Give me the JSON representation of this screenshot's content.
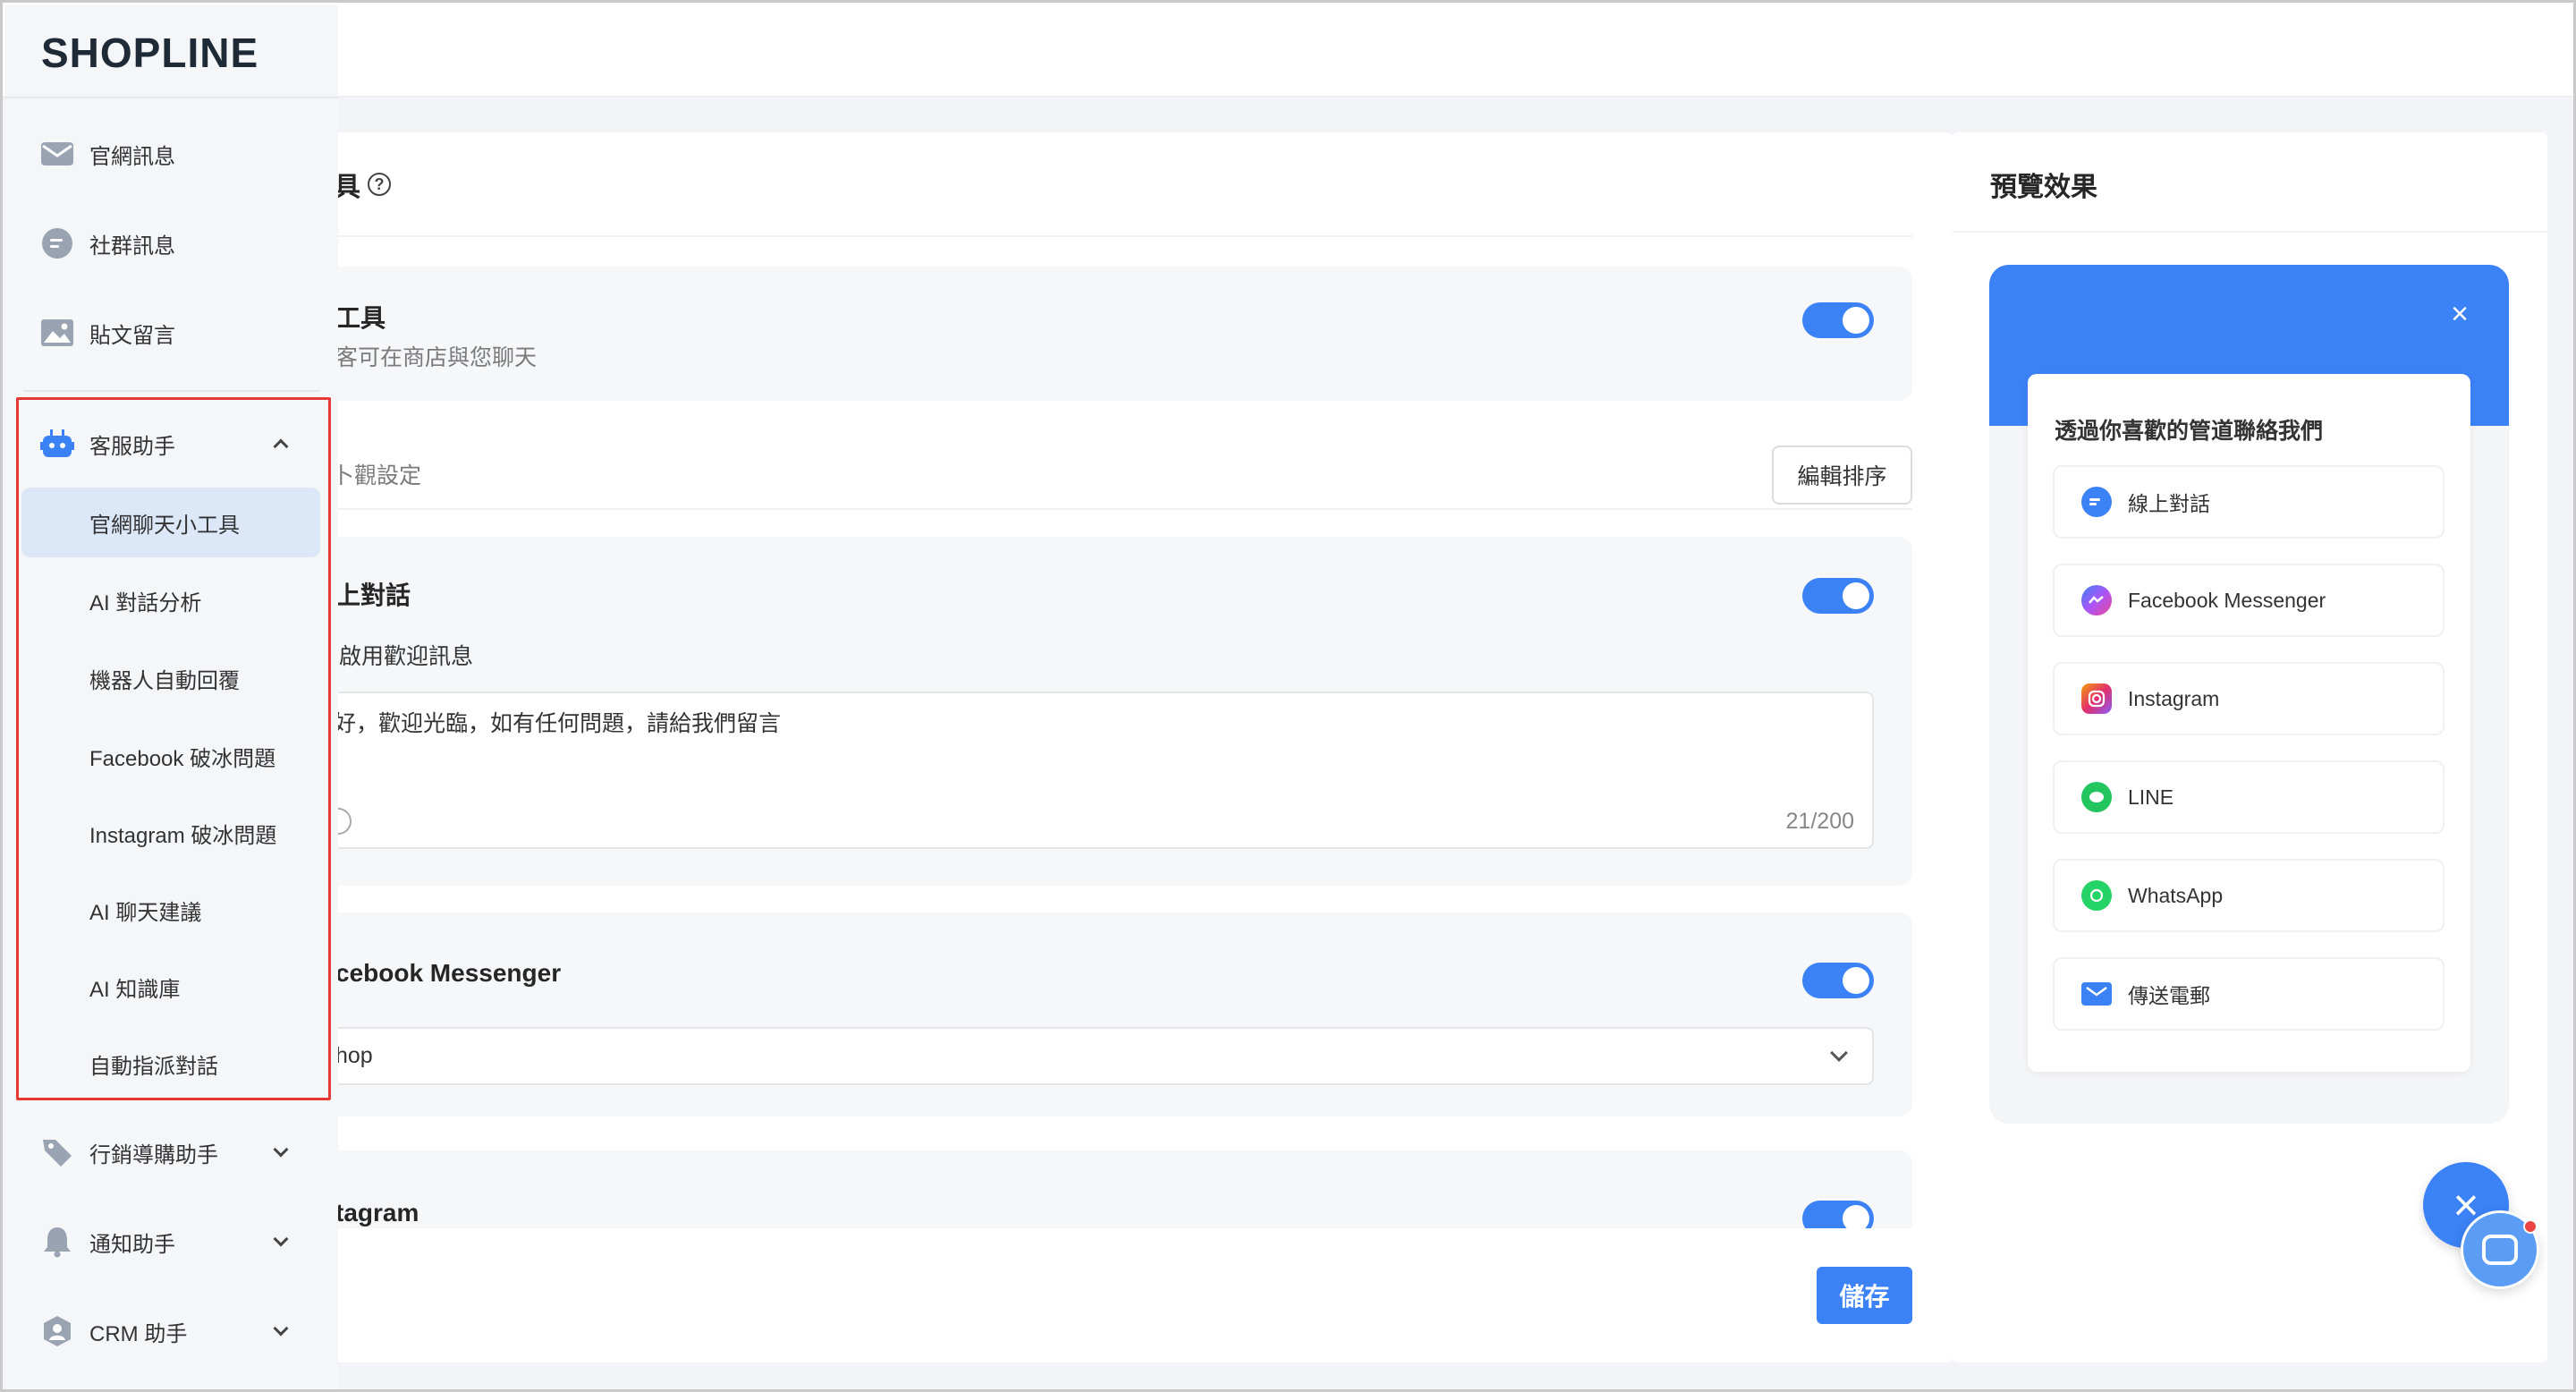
{
  "colors": {
    "accent": "#3b82f6",
    "highlight": "#e53935",
    "sidebar_active": "#dce7f8"
  },
  "sidebar": {
    "logo": "SHOPLINE",
    "items": [
      {
        "label": "官網訊息",
        "icon": "mail-icon"
      },
      {
        "label": "社群訊息",
        "icon": "chat-bubble-icon"
      },
      {
        "label": "貼文留言",
        "icon": "image-icon"
      }
    ],
    "group": {
      "label": "客服助手",
      "icon": "robot-icon",
      "expanded": true,
      "children": [
        {
          "label": "官網聊天小工具",
          "active": true
        },
        {
          "label": "AI 對話分析"
        },
        {
          "label": "機器人自動回覆"
        },
        {
          "label": "Facebook 破冰問題"
        },
        {
          "label": "Instagram 破冰問題"
        },
        {
          "label": "AI 聊天建議"
        },
        {
          "label": "AI 知識庫"
        },
        {
          "label": "自動指派對話"
        }
      ]
    },
    "collapsed_groups": [
      {
        "label": "行銷導購助手",
        "icon": "tag-icon"
      },
      {
        "label": "通知助手",
        "icon": "bell-icon"
      },
      {
        "label": "CRM 助手",
        "icon": "crm-icon"
      }
    ]
  },
  "main": {
    "heading": "具",
    "chat_tool": {
      "title": "工具",
      "subtitle": "客可在商店與您聊天",
      "enabled": true
    },
    "appearance": {
      "label": "卜觀設定",
      "sort_button": "編輯排序"
    },
    "live_chat": {
      "title": "上對話",
      "enabled": true,
      "welcome_label": "啟用歡迎訊息",
      "welcome_text": "好，歡迎光臨，如有任何問題，請給我們留言",
      "char_count": "21/200"
    },
    "facebook": {
      "title": "cebook Messenger",
      "enabled": true,
      "selected_page": "hop"
    },
    "instagram": {
      "title": "tagram",
      "enabled": true
    },
    "save_button": "儲存"
  },
  "preview": {
    "title": "預覽效果",
    "widget_heading": "透過你喜歡的管道聯絡我們",
    "channels": [
      {
        "label": "線上對話",
        "icon": "live-chat-icon",
        "color": "#3b82f6"
      },
      {
        "label": "Facebook Messenger",
        "icon": "messenger-icon",
        "color": "#8b5cf6"
      },
      {
        "label": "Instagram",
        "icon": "instagram-icon",
        "color": "#e1306c"
      },
      {
        "label": "LINE",
        "icon": "line-icon",
        "color": "#22c55e"
      },
      {
        "label": "WhatsApp",
        "icon": "whatsapp-icon",
        "color": "#25d366"
      },
      {
        "label": "傳送電郵",
        "icon": "email-icon",
        "color": "#3b82f6"
      }
    ]
  }
}
